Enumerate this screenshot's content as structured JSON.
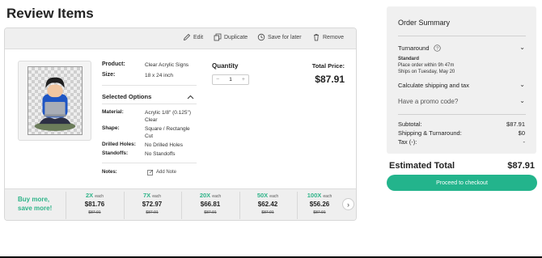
{
  "page": {
    "title": "Review Items"
  },
  "toolbar": {
    "edit": "Edit",
    "duplicate": "Duplicate",
    "save_later": "Save for later",
    "remove": "Remove"
  },
  "item": {
    "product_label": "Product:",
    "product_value": "Clear Acrylic Signs",
    "size_label": "Size:",
    "size_value": "18 x 24 inch",
    "selected_options_label": "Selected Options",
    "options": [
      {
        "label": "Material:",
        "value": "Acrylic 1/8\" (0.125\") Clear"
      },
      {
        "label": "Shape:",
        "value": "Square / Rectangle Cut"
      },
      {
        "label": "Drilled Holes:",
        "value": "No Drilled Holes"
      },
      {
        "label": "Standoffs:",
        "value": "No Standoffs"
      }
    ],
    "notes_label": "Notes:",
    "add_note": "Add Note",
    "quantity_label": "Quantity",
    "quantity_value": "1",
    "total_price_label": "Total Price:",
    "total_price_value": "$87.91"
  },
  "tiers": {
    "buy_more_line1": "Buy more,",
    "buy_more_line2": "save more!",
    "each_label": "each",
    "items": [
      {
        "qty": "2X",
        "price": "$81.76",
        "orig": "$87.91"
      },
      {
        "qty": "7X",
        "price": "$72.97",
        "orig": "$87.91"
      },
      {
        "qty": "20X",
        "price": "$66.81",
        "orig": "$87.91"
      },
      {
        "qty": "50X",
        "price": "$62.42",
        "orig": "$87.91"
      },
      {
        "qty": "100X",
        "price": "$56.26",
        "orig": "$87.91"
      }
    ]
  },
  "summary": {
    "title": "Order Summary",
    "turnaround_label": "Turnaround",
    "turnaround_type": "Standard",
    "turnaround_line1": "Place order within 9h 47m",
    "turnaround_line2": "Ships on Tuesday, May 20",
    "shipping_calc": "Calculate shipping and tax",
    "promo": "Have a promo code?",
    "subtotal_label": "Subtotal:",
    "subtotal_value": "$87.91",
    "shipping_label": "Shipping & Turnaround:",
    "shipping_value": "$0",
    "tax_label": "Tax (-):",
    "tax_value": "-",
    "estimated_label": "Estimated Total",
    "estimated_value": "$87.91",
    "checkout": "Proceed to checkout"
  },
  "colors": {
    "accent": "#23b48c",
    "accent_text": "#2fb489"
  }
}
